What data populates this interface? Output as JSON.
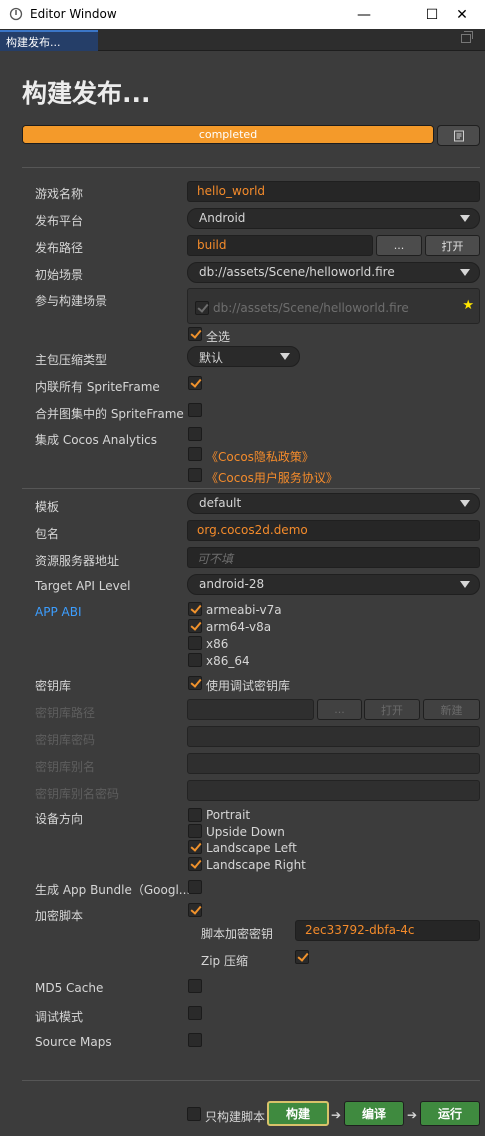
{
  "window": {
    "title": "Editor Window",
    "minimize": "—",
    "maximize": "☐",
    "close": "✕"
  },
  "tab": {
    "label": "构建发布..."
  },
  "heading": "构建发布...",
  "progress": {
    "label": "completed",
    "value": 100
  },
  "fields": {
    "game_name": {
      "label": "游戏名称",
      "value": "hello_world"
    },
    "platform": {
      "label": "发布平台",
      "value": "Android"
    },
    "build_path": {
      "label": "发布路径",
      "value": "build",
      "browse": "...",
      "open": "打开"
    },
    "start_scene": {
      "label": "初始场景",
      "value": "db://assets/Scene/helloworld.fire"
    },
    "scenes": {
      "label": "参与构建场景",
      "scene": "db://assets/Scene/helloworld.fire",
      "select_all": "全选"
    },
    "compression": {
      "label": "主包压缩类型",
      "value": "默认"
    },
    "inline_spriteframe": {
      "label": "内联所有 SpriteFrame"
    },
    "merge_spriteframe": {
      "label": "合并图集中的 SpriteFrame"
    },
    "analytics": {
      "label": "集成 Cocos Analytics",
      "privacy": "《Cocos隐私政策》",
      "agreement": "《Cocos用户服务协议》"
    },
    "template": {
      "label": "模板",
      "value": "default"
    },
    "package_name": {
      "label": "包名",
      "value": "org.cocos2d.demo"
    },
    "resource_server": {
      "label": "资源服务器地址",
      "placeholder": "可不填"
    },
    "api_level": {
      "label": "Target API Level",
      "value": "android-28"
    },
    "app_abi": {
      "label": "APP ABI",
      "options": [
        "armeabi-v7a",
        "arm64-v8a",
        "x86",
        "x86_64"
      ]
    },
    "keystore": {
      "label": "密钥库",
      "use_debug": "使用调试密钥库"
    },
    "keystore_path": {
      "label": "密钥库路径",
      "browse": "...",
      "open": "打开",
      "new": "新建"
    },
    "keystore_password": {
      "label": "密钥库密码"
    },
    "keystore_alias": {
      "label": "密钥库别名"
    },
    "keystore_alias_password": {
      "label": "密钥库别名密码"
    },
    "orientation": {
      "label": "设备方向",
      "options": [
        "Portrait",
        "Upside Down",
        "Landscape Left",
        "Landscape Right"
      ]
    },
    "app_bundle": {
      "label": "生成 App Bundle（Googl..."
    },
    "encrypt": {
      "label": "加密脚本",
      "key_label": "脚本加密密钥",
      "key_value": "2ec33792-dbfa-4c",
      "zip_label": "Zip 压缩"
    },
    "md5": {
      "label": "MD5 Cache"
    },
    "debug": {
      "label": "调试模式"
    },
    "source_maps": {
      "label": "Source Maps"
    }
  },
  "footer": {
    "build_script_only": "只构建脚本",
    "build": "构建",
    "compile": "编译",
    "run": "运行"
  },
  "colors": {
    "accent": "#f49a2a",
    "green": "#3f8a3f",
    "blue_label": "#3c9eff"
  }
}
